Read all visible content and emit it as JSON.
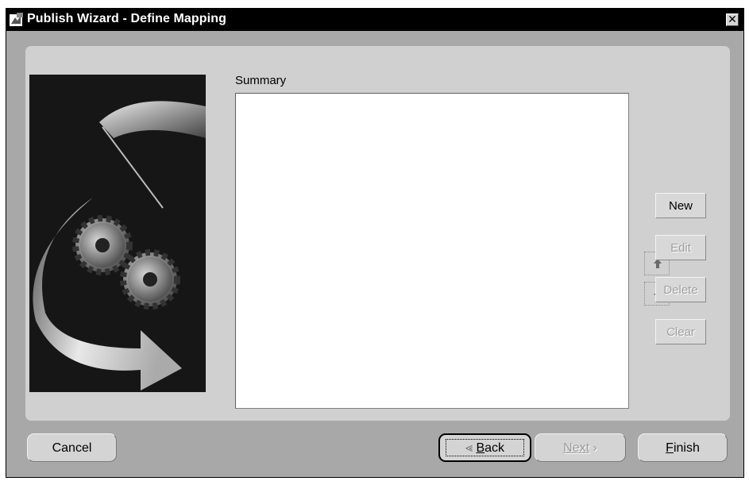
{
  "window": {
    "title": "Publish Wizard - Define Mapping",
    "close_glyph": "✕"
  },
  "summary": {
    "label": "Summary",
    "items": []
  },
  "side_buttons": {
    "new": "New",
    "edit": "Edit",
    "delete": "Delete",
    "clear": "Clear"
  },
  "footer": {
    "cancel": "Cancel",
    "back_mnemonic": "B",
    "back_rest": "ack",
    "next": "Next",
    "finish_mnemonic": "F",
    "finish_rest": "inish"
  },
  "states": {
    "edit_enabled": false,
    "delete_enabled": false,
    "clear_enabled": false,
    "next_enabled": false,
    "focused_button": "back"
  },
  "icons": {
    "app": "wizard-app-icon",
    "close": "close-icon",
    "move_up": "arrow-up-icon",
    "move_down": "arrow-down-icon",
    "back_chevron": "chevron-left-icon",
    "next_chevron": "chevron-right-icon",
    "illustration": "gears-arrow-illustration"
  },
  "colors": {
    "titlebar": "#000000",
    "window_bg": "#a8a8a8",
    "panel_bg": "#d0d0d0",
    "disabled_text": "#a0a0a0"
  }
}
